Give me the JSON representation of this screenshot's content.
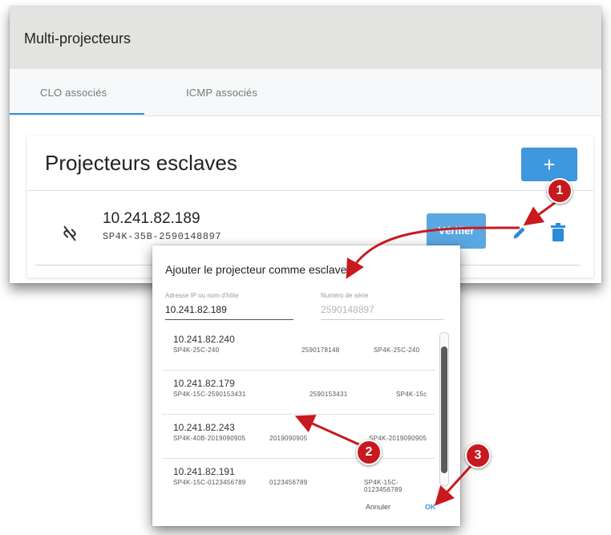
{
  "window": {
    "title": "Multi-projecteurs"
  },
  "tabs": [
    {
      "label": "CLO associés",
      "active": true
    },
    {
      "label": "ICMP associés",
      "active": false
    }
  ],
  "card": {
    "title": "Projecteurs esclaves",
    "add_label": "+",
    "projector": {
      "ip": "10.241.82.189",
      "id": "SP4K-35B-2590148897",
      "verify_label": "Vérifier"
    }
  },
  "dialog": {
    "title": "Ajouter le projecteur comme esclave",
    "ip_label": "Adresse IP ou nom d'hôte",
    "ip_value": "10.241.82.189",
    "serial_label": "Numéro de série",
    "serial_value": "2590148897",
    "items": [
      {
        "ip": "10.241.82.240",
        "c1": "SP4K-25C-240",
        "c2": "2590178148",
        "c3": "SP4K-25C-240"
      },
      {
        "ip": "10.241.82.179",
        "c1": "SP4K-15C-2590153431",
        "c2": "2590153431",
        "c3": "SP4K-15c"
      },
      {
        "ip": "10.241.82.243",
        "c1": "SP4K-40B-2019090905",
        "c2": "2019090905",
        "c3": "SP4K-2019090905"
      },
      {
        "ip": "10.241.82.191",
        "c1": "SP4K-15C-0123456789",
        "c2": "0123456789",
        "c3": "SP4K-15C-0123456789"
      }
    ],
    "cancel_label": "Annuler",
    "ok_label": "OK"
  },
  "annotations": {
    "step1": "1",
    "step2": "2",
    "step3": "3",
    "color": "#c8191f"
  },
  "colors": {
    "accent": "#3f97de",
    "header_bg": "#e3e3e1"
  },
  "icons": [
    "link-off-icon",
    "pencil-icon",
    "trash-icon"
  ]
}
